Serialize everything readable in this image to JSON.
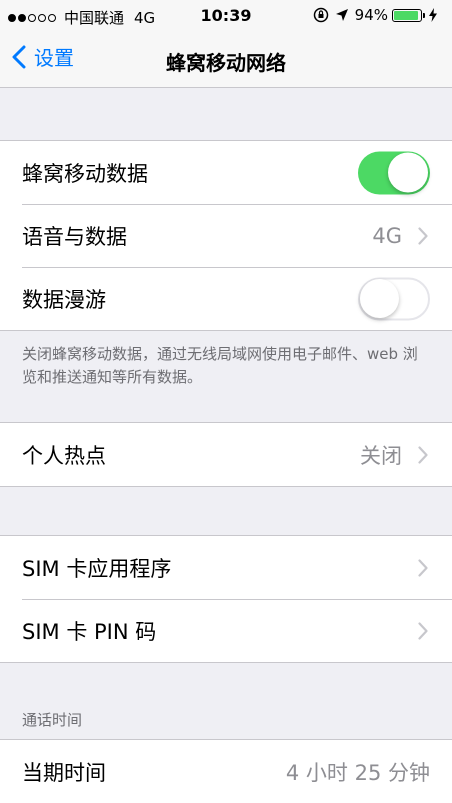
{
  "status_bar": {
    "carrier": "中国联通",
    "network": "4G",
    "time": "10:39",
    "battery_percent": "94%",
    "battery_level": 0.94,
    "signal_bars_filled": 2,
    "signal_bars_total": 5
  },
  "nav": {
    "back_label": "设置",
    "title": "蜂窝移动网络"
  },
  "cellular": {
    "data_label": "蜂窝移动数据",
    "data_on": true,
    "voice_data_label": "语音与数据",
    "voice_data_value": "4G",
    "roaming_label": "数据漫游",
    "roaming_on": false,
    "footnote": "关闭蜂窝移动数据，通过无线局域网使用电子邮件、web 浏览和推送通知等所有数据。"
  },
  "hotspot": {
    "label": "个人热点",
    "value": "关闭"
  },
  "sim": {
    "apps_label": "SIM 卡应用程序",
    "pin_label": "SIM 卡 PIN 码"
  },
  "call_time": {
    "header": "通话时间",
    "current_label": "当期时间",
    "current_value": "4 小时 25 分钟"
  },
  "colors": {
    "accent": "#007aff",
    "toggle_on": "#4cd964",
    "background": "#efeff4"
  }
}
